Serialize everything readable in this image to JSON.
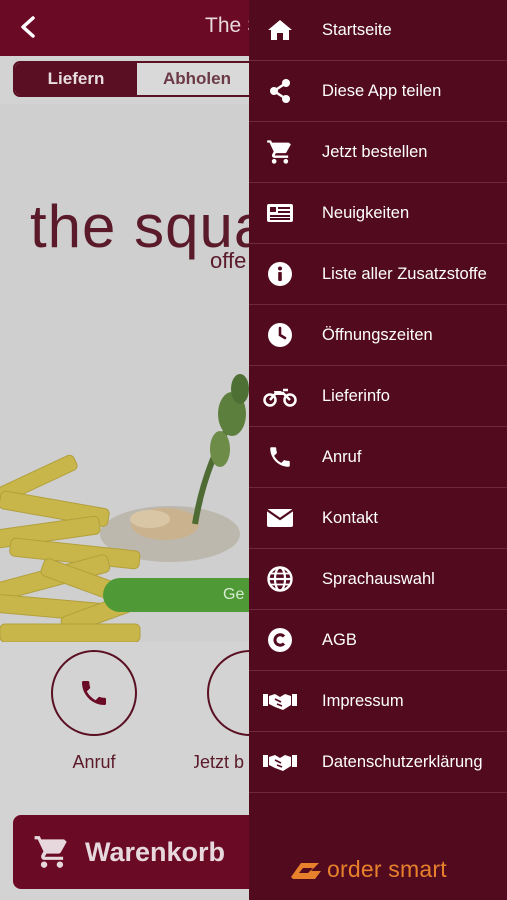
{
  "app": {
    "title": "The S",
    "tabs": {
      "deliver": "Liefern",
      "pickup": "Abholen"
    },
    "brand": {
      "main": "the squa",
      "sub": "offe"
    },
    "status": "Ge",
    "quick_actions": {
      "call": "Anruf",
      "order": "Jetzt b"
    },
    "cart": "Warenkorb"
  },
  "menu": {
    "items": [
      {
        "label": "Startseite",
        "icon": "home-icon"
      },
      {
        "label": "Diese App teilen",
        "icon": "share-icon"
      },
      {
        "label": "Jetzt bestellen",
        "icon": "cart-icon"
      },
      {
        "label": "Neuigkeiten",
        "icon": "news-icon"
      },
      {
        "label": "Liste aller Zusatzstoffe",
        "icon": "info-icon"
      },
      {
        "label": "Öffnungszeiten",
        "icon": "clock-icon"
      },
      {
        "label": "Lieferinfo",
        "icon": "motorcycle-icon"
      },
      {
        "label": "Anruf",
        "icon": "phone-icon"
      },
      {
        "label": "Kontakt",
        "icon": "envelope-icon"
      },
      {
        "label": "Sprachauswahl",
        "icon": "globe-icon"
      },
      {
        "label": "AGB",
        "icon": "copyright-icon"
      },
      {
        "label": "Impressum",
        "icon": "handshake-icon"
      },
      {
        "label": "Datenschutzerklärung",
        "icon": "handshake-icon"
      }
    ]
  },
  "footer": {
    "logo_text": "order smart"
  },
  "colors": {
    "topbar": "#6b0a24",
    "drawer": "#510a1e",
    "logo": "#e8812c",
    "status": "#4f9a37"
  }
}
